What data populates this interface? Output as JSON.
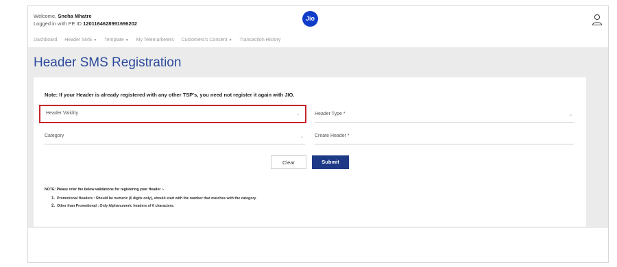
{
  "header": {
    "welcome_prefix": "Welcome,",
    "user_name": "Sneha Mhatre",
    "pe_prefix": "Logged in with PE ID",
    "pe_id": "1201164628991696202",
    "logo_text": "Jio"
  },
  "nav": {
    "items": [
      {
        "label": "Dashboard",
        "dropdown": false
      },
      {
        "label": "Header SMS",
        "dropdown": true
      },
      {
        "label": "Template",
        "dropdown": true
      },
      {
        "label": "My Telemarketers",
        "dropdown": false
      },
      {
        "label": "Customers's Consent",
        "dropdown": true
      },
      {
        "label": "Transaction History",
        "dropdown": false
      }
    ]
  },
  "page": {
    "title": "Header SMS Registration",
    "note": "Note: If your Header is already registered with any other TSP's, you need not register it again with JIO."
  },
  "form": {
    "header_validity": "Header Validity",
    "header_type": "Header Type *",
    "category": "Category",
    "create_header": "Create Header *",
    "clear_label": "Clear",
    "submit_label": "Submit"
  },
  "validation_note": {
    "title": "NOTE: Please refer the below validations for registering your Header :-",
    "items": [
      {
        "num": "1.",
        "text": "Promotional Headers : Should be numeric (6 digits only), should start with the number that matches with the category."
      },
      {
        "num": "2.",
        "text": "Other than Promotional : Only Alphanumeric headers of 6 characters."
      }
    ]
  },
  "colors": {
    "title_blue": "#2a4a9e",
    "submit_bg": "#1e3a87",
    "highlight_red": "#c8232a",
    "logo_blue": "#0f3cc9"
  }
}
